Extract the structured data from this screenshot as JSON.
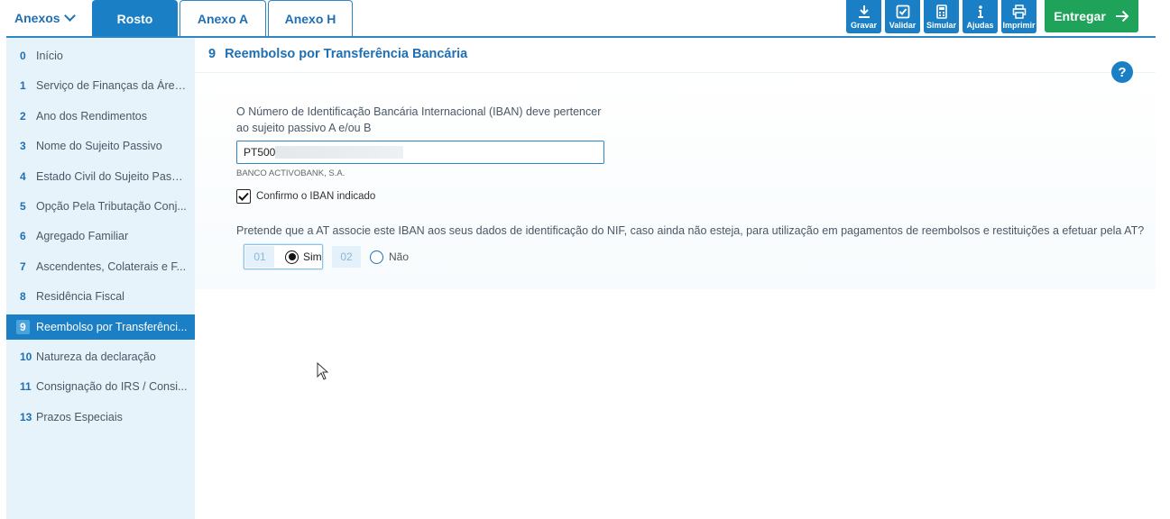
{
  "topbar": {
    "anexos_label": "Anexos",
    "tabs": [
      {
        "label": "Rosto",
        "active": true
      },
      {
        "label": "Anexo A",
        "active": false
      },
      {
        "label": "Anexo H",
        "active": false
      }
    ],
    "tools": {
      "gravar": "Gravar",
      "validar": "Validar",
      "simular": "Simular",
      "ajudas": "Ajudas",
      "imprimir": "Imprimir"
    },
    "entregar_label": "Entregar",
    "accent_color": "#1a7fc4",
    "entregar_color": "#1fa35a"
  },
  "sidebar": {
    "items": [
      {
        "num": "0",
        "label": "Início",
        "active": false
      },
      {
        "num": "1",
        "label": "Serviço de Finanças da Área...",
        "active": false
      },
      {
        "num": "2",
        "label": "Ano dos Rendimentos",
        "active": false
      },
      {
        "num": "3",
        "label": "Nome do Sujeito Passivo",
        "active": false
      },
      {
        "num": "4",
        "label": "Estado Civil do Sujeito Passi...",
        "active": false
      },
      {
        "num": "5",
        "label": "Opção Pela Tributação Conj...",
        "active": false
      },
      {
        "num": "6",
        "label": "Agregado Familiar",
        "active": false
      },
      {
        "num": "7",
        "label": "Ascendentes, Colaterais e F...",
        "active": false
      },
      {
        "num": "8",
        "label": "Residência Fiscal",
        "active": false
      },
      {
        "num": "9",
        "label": "Reembolso por Transferênci...",
        "active": true
      },
      {
        "num": "10",
        "label": "Natureza da declaração",
        "active": false
      },
      {
        "num": "11",
        "label": "Consignação do IRS / Consi...",
        "active": false
      },
      {
        "num": "13",
        "label": "Prazos Especiais",
        "active": false
      }
    ]
  },
  "main": {
    "section_number": "9",
    "section_title": "Reembolso por Transferência Bancária",
    "help_label": "?",
    "iban": {
      "label": "O Número de Identificação Bancária Internacional (IBAN) deve pertencer ao sujeito passivo A e/ou B",
      "value_prefix": "PT500",
      "bank_name": "BANCO ACTIVOBANK, S.A.",
      "confirm_label": "Confirmo o IBAN indicado",
      "confirm_checked": true
    },
    "question": {
      "text": "Pretende que a AT associe este IBAN aos seus dados de identificação do NIF, caso ainda não esteja, para utilização em pagamentos de reembolsos e restituições a efetuar pela AT?",
      "options": [
        {
          "code": "01",
          "label": "Sim",
          "selected": true
        },
        {
          "code": "02",
          "label": "Não",
          "selected": false
        }
      ]
    }
  }
}
